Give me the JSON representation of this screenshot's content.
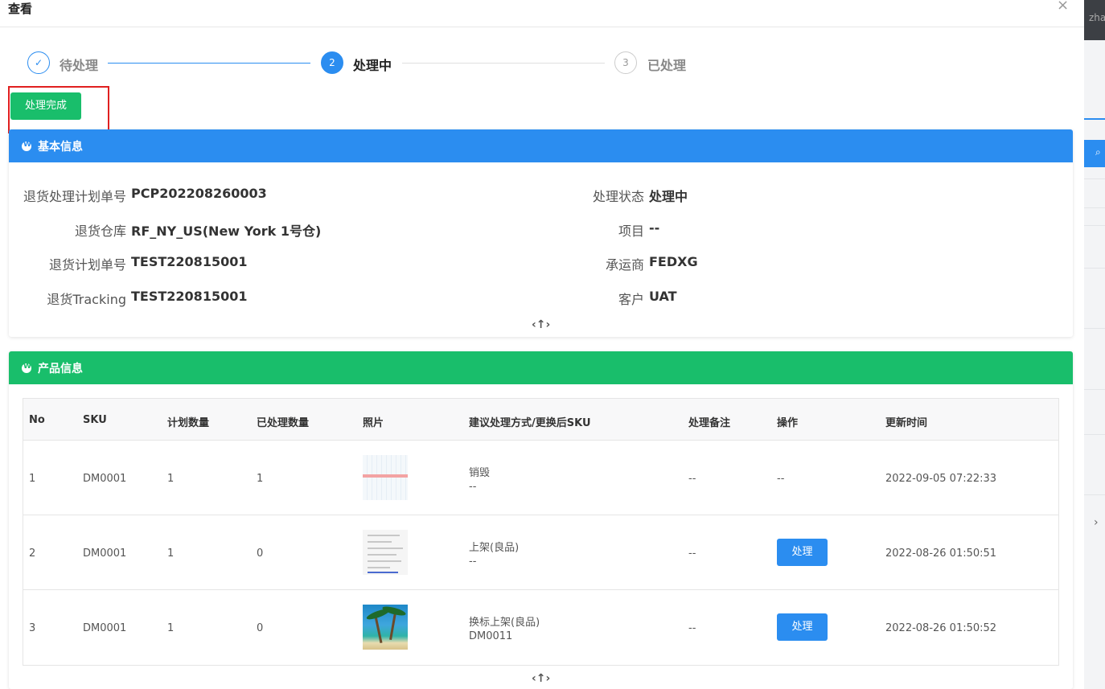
{
  "modal": {
    "title": "查看",
    "close_icon": "×"
  },
  "steps": [
    {
      "label": "待处理",
      "status": "done",
      "icon": "✓"
    },
    {
      "label": "处理中",
      "status": "active",
      "number": "2"
    },
    {
      "label": "已处理",
      "status": "wait",
      "number": "3"
    }
  ],
  "complete_button": "处理完成",
  "basic_info": {
    "title": "基本信息",
    "fields": [
      {
        "label": "退货处理计划单号",
        "value": "PCP202208260003"
      },
      {
        "label": "处理状态",
        "value": "处理中"
      },
      {
        "label": "退货仓库",
        "value": "RF_NY_US(New York 1号仓)"
      },
      {
        "label": "项目",
        "value": "--"
      },
      {
        "label": "退货计划单号",
        "value": "TEST220815001"
      },
      {
        "label": "承运商",
        "value": "FEDXG"
      },
      {
        "label": "退货Tracking",
        "value": "TEST220815001"
      },
      {
        "label": "客户",
        "value": "UAT"
      }
    ],
    "collapse_icon": "‹↑›"
  },
  "product_info": {
    "title": "产品信息",
    "columns": [
      "No",
      "SKU",
      "计划数量",
      "已处理数量",
      "照片",
      "建议处理方式/更换后SKU",
      "处理备注",
      "操作",
      "更新时间"
    ],
    "rows": [
      {
        "no": "1",
        "sku": "DM0001",
        "plan_qty": "1",
        "done_qty": "1",
        "method": "销毁",
        "new_sku": "--",
        "remark": "--",
        "action": "--",
        "updated": "2022-09-05 07:22:33"
      },
      {
        "no": "2",
        "sku": "DM0001",
        "plan_qty": "1",
        "done_qty": "0",
        "method": "上架(良品)",
        "new_sku": "--",
        "remark": "--",
        "action": "处理",
        "updated": "2022-08-26 01:50:51"
      },
      {
        "no": "3",
        "sku": "DM0001",
        "plan_qty": "1",
        "done_qty": "0",
        "method": "换标上架(良品)",
        "new_sku": "DM0011",
        "remark": "--",
        "action": "处理",
        "updated": "2022-08-26 01:50:52"
      }
    ],
    "collapse_icon": "‹↑›"
  },
  "background": {
    "user_text": "zha"
  },
  "colors": {
    "primary": "#2b8df0",
    "success": "#19be6b",
    "highlight": "#e02020"
  }
}
